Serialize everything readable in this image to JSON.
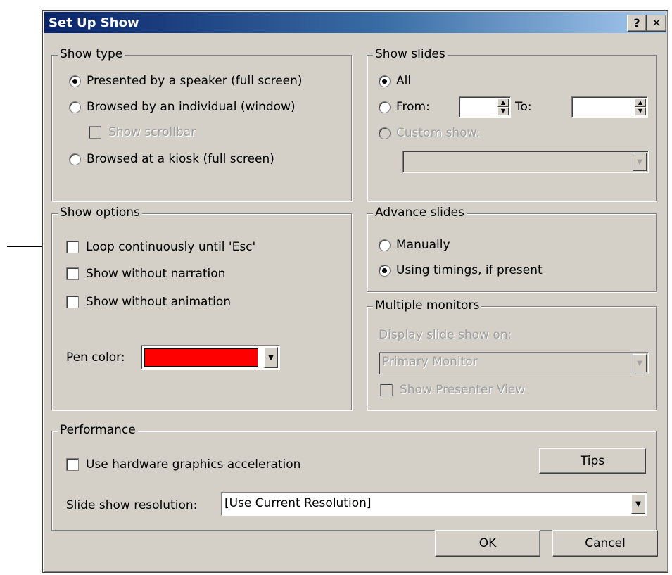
{
  "window": {
    "title": "Set Up Show",
    "help_label": "?",
    "close_label": "✕"
  },
  "show_type": {
    "legend": "Show type",
    "options": [
      {
        "label": "Presented by a speaker (full screen)",
        "selected": true
      },
      {
        "label": "Browsed by an individual (window)",
        "selected": false
      },
      {
        "label": "Browsed at a kiosk (full screen)",
        "selected": false
      }
    ],
    "scrollbar_label": "Show scrollbar"
  },
  "show_slides": {
    "legend": "Show slides",
    "all_label": "All",
    "from_label": "From:",
    "to_label": "To:",
    "from_value": "",
    "to_value": "",
    "custom_label": "Custom show:",
    "custom_value": ""
  },
  "show_options": {
    "legend": "Show options",
    "loop_label": "Loop continuously until 'Esc'",
    "narration_label": "Show without narration",
    "animation_label": "Show without animation",
    "pen_color_label": "Pen color:",
    "pen_color": "#ff0000"
  },
  "advance_slides": {
    "legend": "Advance slides",
    "manually_label": "Manually",
    "timings_label": "Using timings, if present",
    "selected": "timings"
  },
  "multiple_monitors": {
    "legend": "Multiple monitors",
    "display_label": "Display slide show on:",
    "monitor_value": "Primary Monitor",
    "presenter_label": "Show Presenter View"
  },
  "performance": {
    "legend": "Performance",
    "hw_accel_label": "Use hardware graphics acceleration",
    "tips_label": "Tips",
    "resolution_label": "Slide show resolution:",
    "resolution_value": "[Use Current Resolution]"
  },
  "buttons": {
    "ok_label": "OK",
    "cancel_label": "Cancel"
  },
  "icons": {
    "dropdown": "▼",
    "spin_up": "▲",
    "spin_down": "▼"
  },
  "colors": {
    "title_gradient_start": "#0a246a",
    "title_gradient_end": "#a6caf0",
    "dialog_face": "#d4d0c8"
  }
}
